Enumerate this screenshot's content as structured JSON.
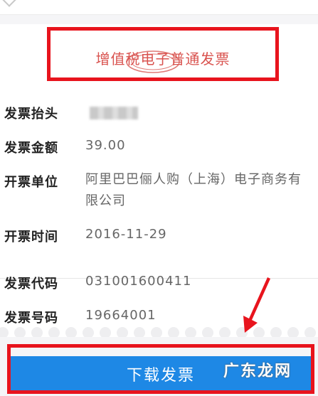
{
  "invoice": {
    "title": "增值税电子普通发票",
    "fields": [
      {
        "label": "发票抬头",
        "value": ""
      },
      {
        "label": "发票金额",
        "value": "39.00"
      },
      {
        "label": "开票单位",
        "value": "阿里巴巴俪人购（上海）电子商务有限公司"
      },
      {
        "label": "开票时间",
        "value": "2016-11-29"
      },
      {
        "label": "发票代码",
        "value": "031001600411"
      },
      {
        "label": "发票号码",
        "value": "19664001"
      }
    ]
  },
  "download_button": {
    "label": "下载发票"
  },
  "watermark": "广东龙网",
  "colors": {
    "accent": "#1e88e5",
    "highlight": "#e8141d",
    "title_red": "#d9534f"
  },
  "icons": {
    "arrow": "red-pointer-arrow",
    "stamp": "invoice-oval-stamp",
    "collapse": "chevron-icon"
  }
}
